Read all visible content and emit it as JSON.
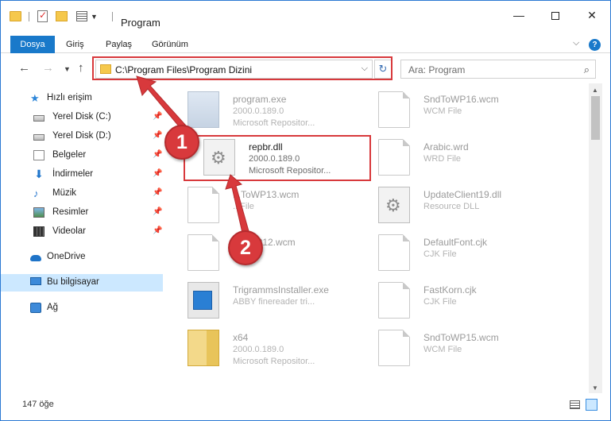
{
  "window": {
    "title": "Program",
    "minimize_glyph": "—",
    "close_glyph": "✕"
  },
  "ribbon": {
    "tabs": [
      "Dosya",
      "Giriş",
      "Paylaş",
      "Görünüm"
    ],
    "help_glyph": "?"
  },
  "navigation": {
    "address": "C:\\Program Files\\Program Dizini",
    "search_placeholder": "Ara: Program"
  },
  "sidebar": {
    "quick_access": "Hızlı erişim",
    "items": [
      "Yerel Disk (C:)",
      "Yerel Disk (D:)",
      "Belgeler",
      "İndirmeler",
      "Müzik",
      "Resimler",
      "Videolar"
    ],
    "onedrive": "OneDrive",
    "this_pc": "Bu bilgisayar",
    "network": "Ağ"
  },
  "files": [
    {
      "name": "program.exe",
      "line1": "2000.0.189.0",
      "line2": "Microsoft Repositor...",
      "icon": "exe-icon"
    },
    {
      "name": "SndToWP16.wcm",
      "line1": "WCM File",
      "line2": "",
      "icon": "page-icon"
    },
    {
      "name": "repbr.dll",
      "line1": "2000.0.189.0",
      "line2": "Microsoft Repositor...",
      "icon": "gear-icon"
    },
    {
      "name": "Arabic.wrd",
      "line1": "WRD File",
      "line2": "",
      "icon": "page-icon"
    },
    {
      "name": "...ToWP13.wcm",
      "line1": "...File",
      "line2": "",
      "icon": "page-icon"
    },
    {
      "name": "UpdateClient19.dll",
      "line1": "Resource DLL",
      "line2": "",
      "icon": "gear-icon"
    },
    {
      "name": "S...WP12.wcm",
      "line1": "...",
      "line2": "",
      "icon": "page-icon"
    },
    {
      "name": "DefaultFont.cjk",
      "line1": "CJK File",
      "line2": "",
      "icon": "page-icon"
    },
    {
      "name": "TrigrammsInstaller.exe",
      "line1": "ABBY finereader tri...",
      "line2": "",
      "icon": "blue-icon"
    },
    {
      "name": "FastKorn.cjk",
      "line1": "CJK File",
      "line2": "",
      "icon": "page-icon"
    },
    {
      "name": "x64",
      "line1": "2000.0.189.0",
      "line2": "Microsoft Repositor...",
      "icon": "zip-icon"
    },
    {
      "name": "SndToWP15.wcm",
      "line1": "WCM File",
      "line2": "",
      "icon": "page-icon"
    }
  ],
  "status": {
    "count": "147 öğe"
  },
  "callouts": {
    "first": "1",
    "second": "2",
    "color": "#d8393c"
  }
}
